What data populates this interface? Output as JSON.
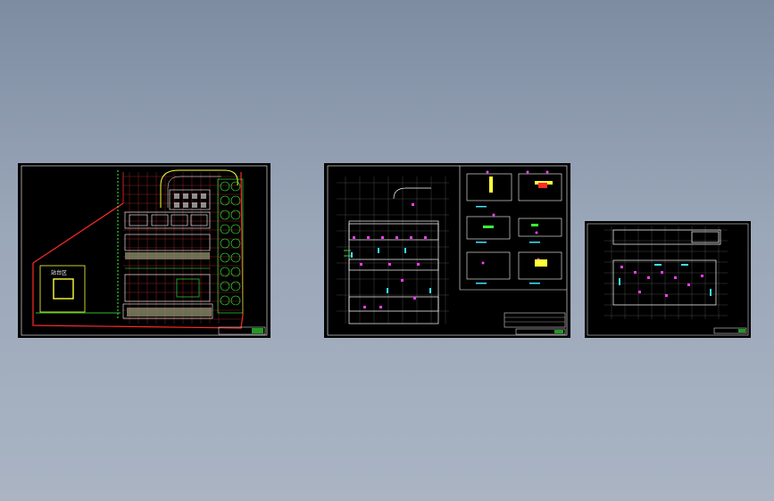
{
  "viewport": {
    "background": "#8f9cb0"
  },
  "sheets": [
    {
      "id": "site-plan",
      "label": "",
      "colors": {
        "boundary": "#ff2a2a",
        "grid": "#ff3b3b",
        "green": "#39ff3a",
        "yellow": "#ffff3a",
        "cyan": "#3fe3ff"
      }
    },
    {
      "id": "floor-plan-details",
      "label": "",
      "colors": {
        "grid": "#ffffff",
        "magenta": "#ff3aff",
        "cyan": "#3fe3ff",
        "green": "#39ff3a"
      }
    },
    {
      "id": "floor-plan-small",
      "label": "",
      "colors": {
        "grid": "#ffffff",
        "magenta": "#ff3aff",
        "cyan": "#3fe3ff"
      }
    }
  ]
}
